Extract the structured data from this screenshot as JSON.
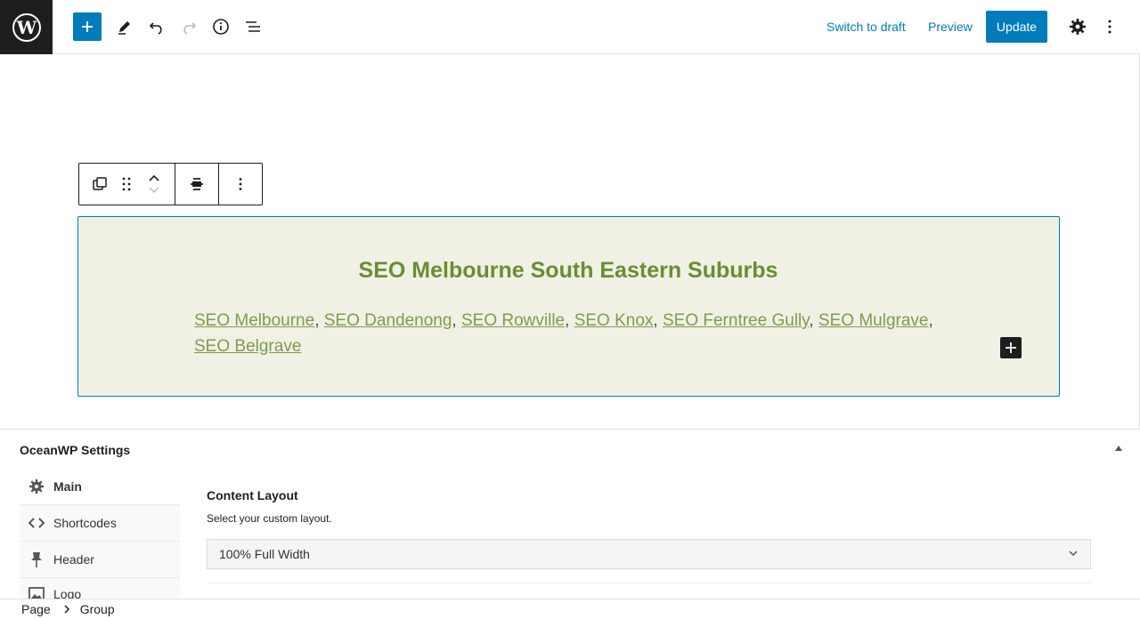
{
  "header": {
    "switch_to_draft": "Switch to draft",
    "preview": "Preview",
    "update": "Update"
  },
  "block": {
    "title": "SEO Melbourne South Eastern Suburbs",
    "links": [
      "SEO Melbourne",
      "SEO Dandenong",
      "SEO Rowville",
      "SEO Knox",
      "SEO Ferntree Gully",
      "SEO Mulgrave",
      "SEO Belgrave"
    ]
  },
  "meta_box": {
    "title": "OceanWP Settings",
    "tabs": [
      {
        "label": "Main",
        "icon": "gear-icon"
      },
      {
        "label": "Shortcodes",
        "icon": "code-icon"
      },
      {
        "label": "Header",
        "icon": "pin-icon"
      },
      {
        "label": "Logo",
        "icon": "image-icon"
      }
    ],
    "content_layout_label": "Content Layout",
    "content_layout_desc": "Select your custom layout.",
    "content_layout_value": "100% Full Width"
  },
  "breadcrumb": {
    "items": [
      "Page",
      "Group"
    ]
  },
  "colors": {
    "accent": "#007cba",
    "group_bg": "#f1f0e5",
    "link_green": "#6a8e33"
  }
}
